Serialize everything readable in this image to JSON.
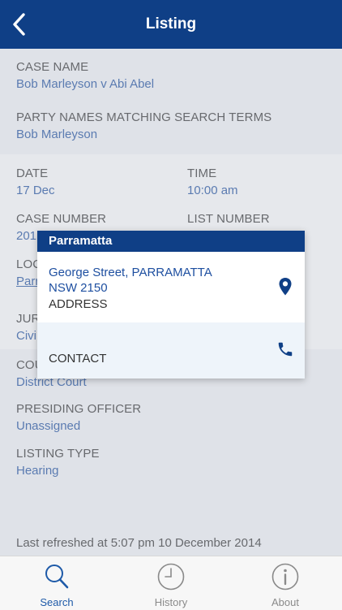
{
  "header": {
    "title": "Listing",
    "back_icon": "chevron-left-icon"
  },
  "case_name": {
    "label": "CASE NAME",
    "value": "Bob Marleyson v Abi Abel"
  },
  "party_names": {
    "label": "PARTY NAMES MATCHING SEARCH TERMS",
    "value": "Bob Marleyson"
  },
  "date": {
    "label": "DATE",
    "value": "17 Dec"
  },
  "time": {
    "label": "TIME",
    "value": "10:00 am"
  },
  "case_number": {
    "label": "CASE NUMBER",
    "value": "201"
  },
  "list_number": {
    "label": "LIST NUMBER"
  },
  "location": {
    "label": "LOC",
    "value": "Parr"
  },
  "jurisdiction": {
    "label": "JUR",
    "value": "Civil"
  },
  "court": {
    "label": "COU",
    "value": "District Court"
  },
  "presiding_officer": {
    "label": "PRESIDING OFFICER",
    "value": "Unassigned"
  },
  "listing_type": {
    "label": "LISTING TYPE",
    "value": "Hearing"
  },
  "last_refreshed": "Last refreshed at 5:07 pm 10 December 2014",
  "popup": {
    "title": "Parramatta",
    "address_line1": "George Street, PARRAMATTA",
    "address_line2": "NSW 2150",
    "address_caption": "ADDRESS",
    "contact_caption": "CONTACT",
    "map_icon": "map-pin-icon",
    "phone_icon": "phone-icon"
  },
  "tabs": [
    {
      "label": "Search",
      "icon": "search-icon",
      "active": true
    },
    {
      "label": "History",
      "icon": "clock-icon",
      "active": false
    },
    {
      "label": "About",
      "icon": "info-icon",
      "active": false
    }
  ],
  "colors": {
    "nav_blue": "#0f3f86",
    "value_blue": "#1e4fa0",
    "active_tab": "#1e5aa8",
    "inactive_tab": "#8a8a8a"
  }
}
